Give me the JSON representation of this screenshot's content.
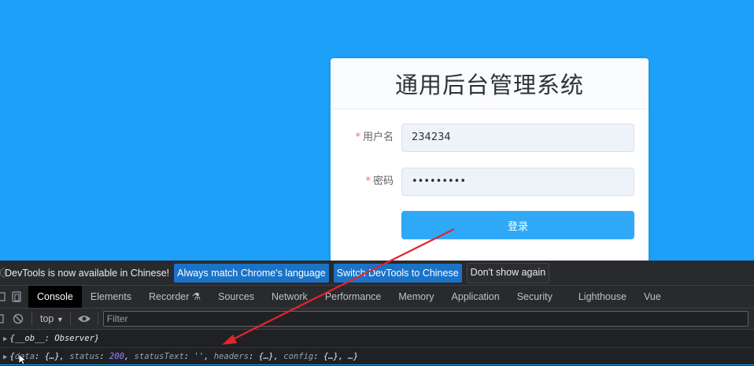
{
  "login": {
    "title": "通用后台管理系统",
    "username_label": "用户名",
    "username_value": "234234",
    "password_label": "密码",
    "password_value": "•••••••••",
    "required_mark": "*",
    "submit_label": "登录"
  },
  "devtools": {
    "infobar": {
      "message": "DevTools is now available in Chinese!",
      "match_button": "Always match Chrome's language",
      "switch_button": "Switch DevTools to Chinese",
      "dismiss_button": "Don't show again"
    },
    "tabs": [
      {
        "label": "Console",
        "active": true
      },
      {
        "label": "Elements"
      },
      {
        "label": "Recorder"
      },
      {
        "label": "Sources"
      },
      {
        "label": "Network"
      },
      {
        "label": "Performance"
      },
      {
        "label": "Memory"
      },
      {
        "label": "Application"
      },
      {
        "label": "Security"
      },
      {
        "label": "Lighthouse"
      },
      {
        "label": "Vue"
      }
    ],
    "context_select": "top",
    "filter_placeholder": "Filter",
    "console_lines": [
      {
        "text": "{__ob__: Observer}"
      },
      {
        "data_key": "data",
        "data_val": "{…}",
        "status_key": "status",
        "status_val": "200",
        "status_text_key": "statusText",
        "status_text_val": "''",
        "headers_key": "headers",
        "headers_val": "{…}",
        "config_key": "config",
        "config_val": "{…}",
        "ellipsis": "…"
      }
    ]
  },
  "colors": {
    "background": "#1da1f8",
    "login_button": "#30a8f8",
    "annotation_arrow": "#e0262b",
    "devtools_primary_button": "#1a73c7"
  },
  "icons": [
    "info-icon",
    "dock-icon",
    "device-toolbar-icon",
    "clear-console-icon",
    "eye-icon",
    "recorder-flask-icon",
    "dropdown-caret-icon",
    "expand-triangle-icon",
    "mouse-cursor-icon",
    "annotation-arrow"
  ]
}
